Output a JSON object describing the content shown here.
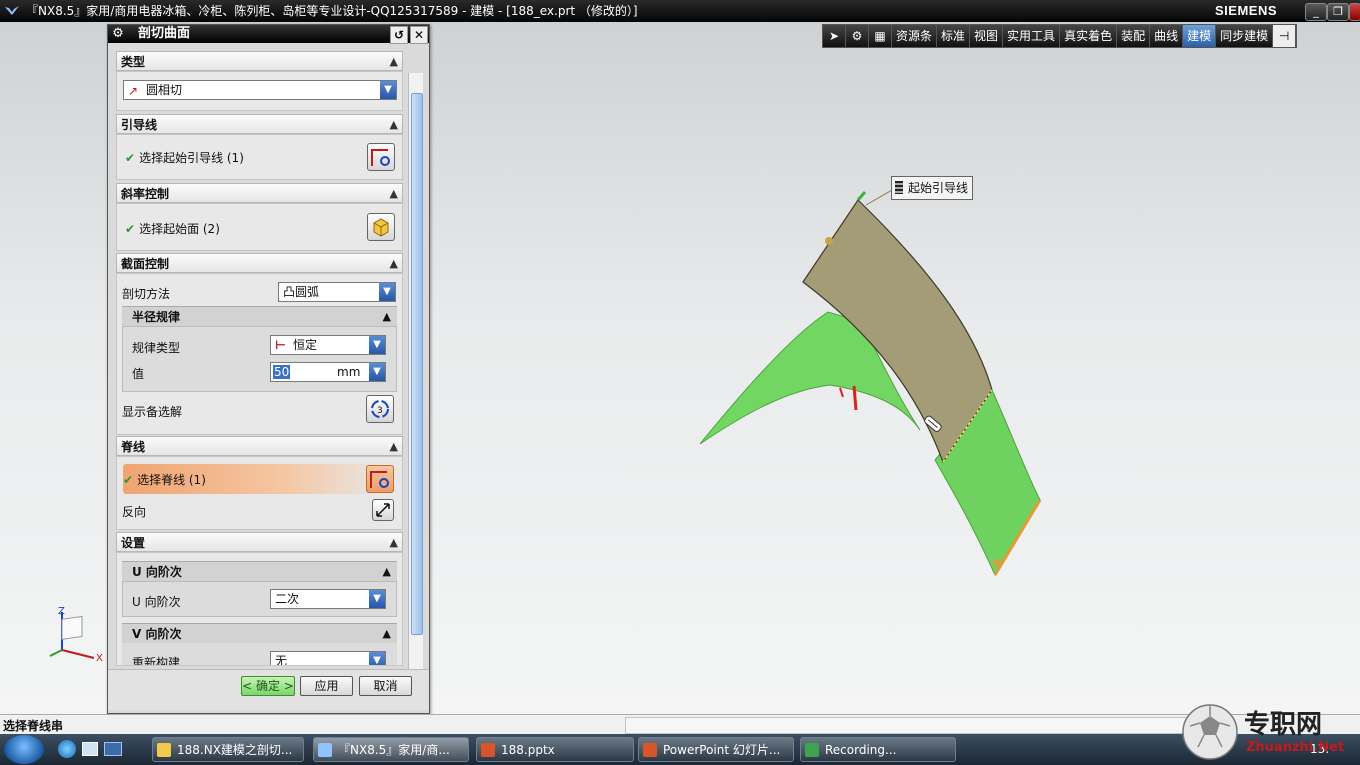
{
  "window": {
    "title": "『NX8.5』家用/商用电器冰箱、冷柜、陈列柜、岛柜等专业设计-QQ125317589 - 建模 - [188_ex.prt （修改的）]",
    "brand": "SIEMENS"
  },
  "toolbar": {
    "items": [
      "资源条",
      "标准",
      "视图",
      "实用工具",
      "真实着色",
      "装配",
      "曲线",
      "建模",
      "同步建模"
    ],
    "active": "建模"
  },
  "dialog": {
    "title": "剖切曲面",
    "type_group": {
      "label": "类型",
      "value": "圆相切"
    },
    "guide_group": {
      "label": "引导线",
      "select_label": "选择起始引导线 (1)"
    },
    "slope_group": {
      "label": "斜率控制",
      "select_label": "选择起始面 (2)"
    },
    "section_group": {
      "label": "截面控制",
      "method_label": "剖切方法",
      "method_value": "凸圆弧",
      "radius_law": {
        "label": "半径规律",
        "law_type_label": "规律类型",
        "law_type_value": "恒定",
        "value_label": "值",
        "value": "50",
        "unit": "mm"
      },
      "alternate_label": "显示备选解"
    },
    "spine_group": {
      "label": "脊线",
      "select_label": "选择脊线 (1)",
      "reverse_label": "反向"
    },
    "settings_group": {
      "label": "设置",
      "u_degree": {
        "label": "U 向阶次",
        "field_label": "U 向阶次",
        "value": "二次"
      },
      "v_degree": {
        "label": "V 向阶次",
        "field_label": "重新构建",
        "value": "无"
      }
    },
    "buttons": {
      "ok": "< 确定 >",
      "apply": "应用",
      "cancel": "取消"
    }
  },
  "viewport": {
    "callout": "起始引导线",
    "triad": {
      "z": "Z",
      "x": "X"
    }
  },
  "status": {
    "prompt": "选择脊线串"
  },
  "taskbar": {
    "items": [
      "188.NX建模之剖切...",
      "『NX8.5』家用/商...",
      "188.pptx",
      "PowerPoint 幻灯片...",
      "Recording..."
    ],
    "clock": "13:"
  },
  "watermark": {
    "text": "专职网",
    "url": "Zhuanzhi.Net"
  },
  "colors": {
    "surface_green": "#6fd15f",
    "surface_tan": "#a39c76",
    "toolbar_active": "#3a72c4",
    "check_green": "#2a9a2a"
  }
}
